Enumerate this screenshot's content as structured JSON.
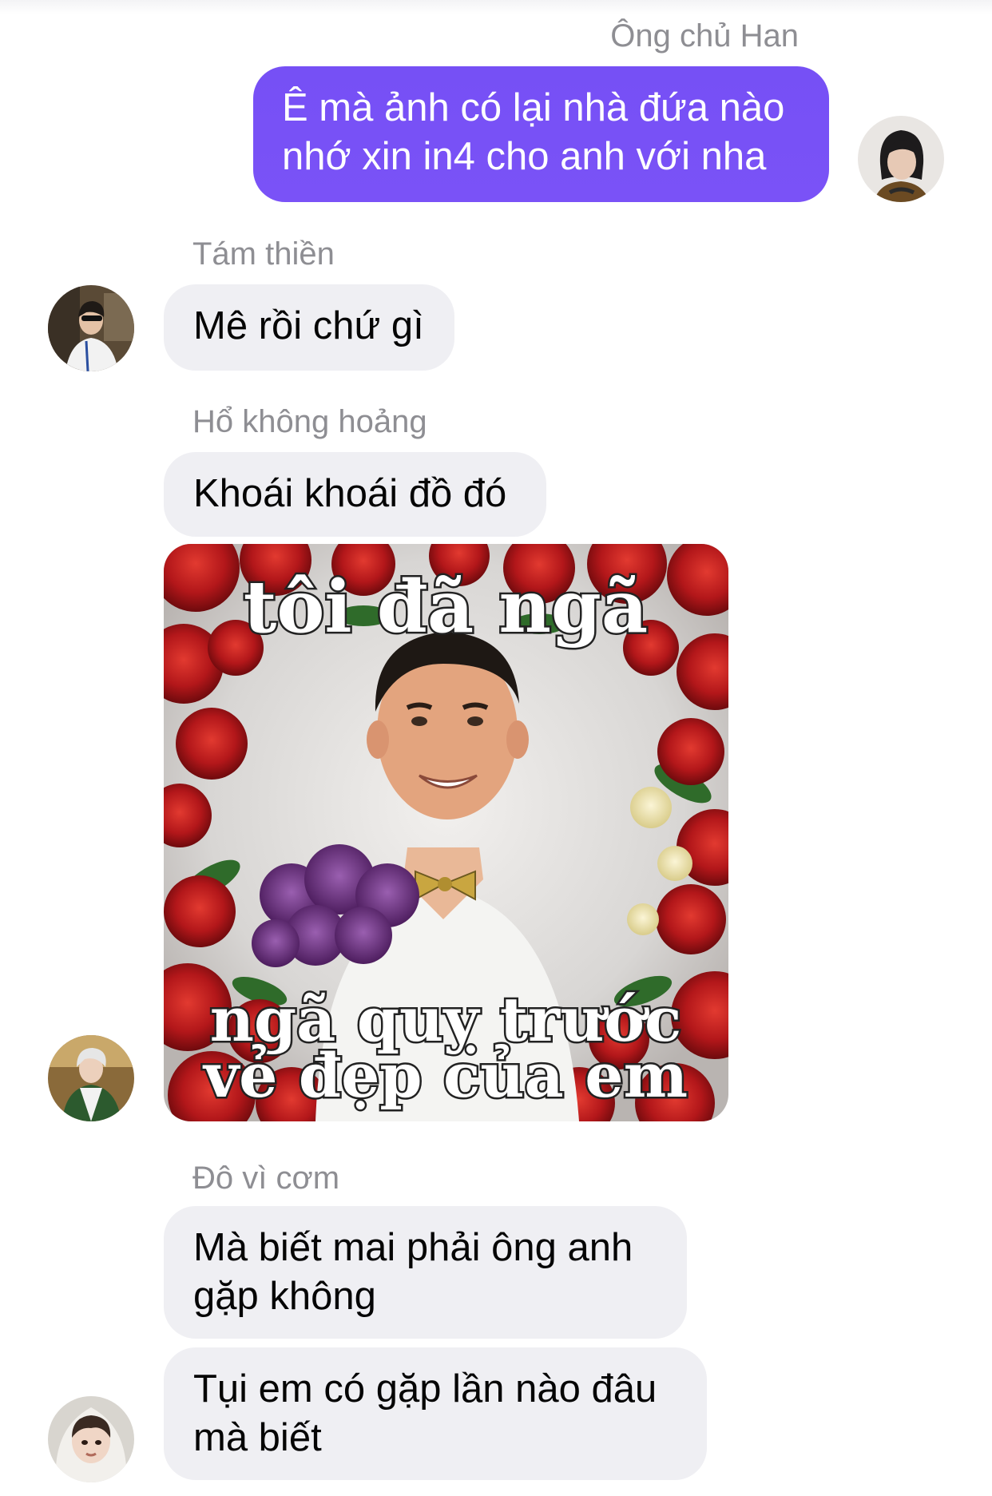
{
  "chat": {
    "messages": [
      {
        "sender": "Ông chủ Han",
        "direction": "outgoing",
        "lines": [
          "Ê mà ảnh có lại nhà đứa nào",
          "nhớ xin in4 cho anh với  nha"
        ]
      },
      {
        "sender": "Tám thiền",
        "direction": "incoming",
        "lines": [
          "Mê rồi chứ gì"
        ]
      },
      {
        "sender": "Hổ không hoảng",
        "direction": "incoming",
        "lines": [
          "Khoái khoái đồ đó"
        ],
        "meme": {
          "caption_top": "tôi đã ngã",
          "caption_bottom_1": "ngã quỵ trước",
          "caption_bottom_2": "vẻ đẹp của em"
        }
      },
      {
        "sender": "Đô vì cơm",
        "direction": "incoming",
        "bubbles": [
          {
            "lines": [
              "Mà biết mai phải ông anh",
              "gặp không"
            ]
          },
          {
            "lines": [
              "Tụi em có gặp lần nào đâu",
              "mà biết"
            ]
          }
        ]
      }
    ]
  },
  "colors": {
    "outgoing_bubble": "#7a52f7",
    "incoming_bubble": "#efeff3",
    "sender_name": "#8e8e93"
  },
  "icons": {
    "avatar": "user-photo-avatar"
  }
}
